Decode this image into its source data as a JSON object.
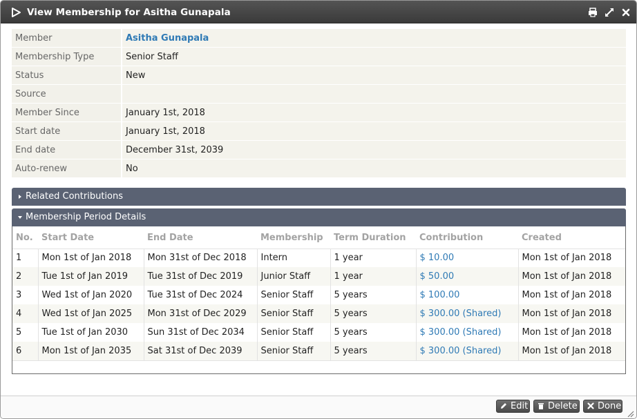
{
  "dialog": {
    "title": "View Membership for Asitha Gunapala"
  },
  "details": [
    {
      "label": "Member",
      "value": "Asitha Gunapala",
      "link": true
    },
    {
      "label": "Membership Type",
      "value": "Senior Staff"
    },
    {
      "label": "Status",
      "value": "New"
    },
    {
      "label": "Source",
      "value": ""
    },
    {
      "label": "Member Since",
      "value": "January 1st, 2018"
    },
    {
      "label": "Start date",
      "value": "January 1st, 2018"
    },
    {
      "label": "End date",
      "value": "December 31st, 2039"
    },
    {
      "label": "Auto-renew",
      "value": "No"
    }
  ],
  "sections": {
    "related_contributions": "Related Contributions",
    "period_details": "Membership Period Details"
  },
  "periods": {
    "columns": [
      "No.",
      "Start Date",
      "End Date",
      "Membership",
      "Term Duration",
      "Contribution",
      "Created"
    ],
    "rows": [
      [
        "1",
        "Mon 1st of Jan 2018",
        "Mon 31st of Dec 2018",
        "Intern",
        "1 year",
        "$ 10.00",
        "Mon 1st of Jan 2018"
      ],
      [
        "2",
        "Tue 1st of Jan 2019",
        "Tue 31st of Dec 2019",
        "Junior Staff",
        "1 year",
        "$ 50.00",
        "Mon 1st of Jan 2018"
      ],
      [
        "3",
        "Wed 1st of Jan 2020",
        "Tue 31st of Dec 2024",
        "Senior Staff",
        "5 years",
        "$ 100.00",
        "Mon 1st of Jan 2018"
      ],
      [
        "4",
        "Wed 1st of Jan 2025",
        "Mon 31st of Dec 2029",
        "Senior Staff",
        "5 years",
        "$ 300.00 (Shared)",
        "Mon 1st of Jan 2018"
      ],
      [
        "5",
        "Tue 1st of Jan 2030",
        "Sun 31st of Dec 2034",
        "Senior Staff",
        "5 years",
        "$ 300.00 (Shared)",
        "Mon 1st of Jan 2018"
      ],
      [
        "6",
        "Mon 1st of Jan 2035",
        "Sat 31st of Dec 2039",
        "Senior Staff",
        "5 years",
        "$ 300.00 (Shared)",
        "Mon 1st of Jan 2018"
      ]
    ]
  },
  "buttons": {
    "edit": "Edit",
    "delete": "Delete",
    "done": "Done"
  },
  "colors": {
    "titlebar": "#454545",
    "section_header": "#5a6273",
    "link": "#2f7ab5",
    "label_bg": "#f2f1ea"
  },
  "icons": {
    "title": "dialog-icon",
    "print": "print-icon",
    "maximize": "maximize-icon",
    "close": "close-icon",
    "edit": "pencil-icon",
    "delete": "trash-icon",
    "done": "x-icon"
  }
}
